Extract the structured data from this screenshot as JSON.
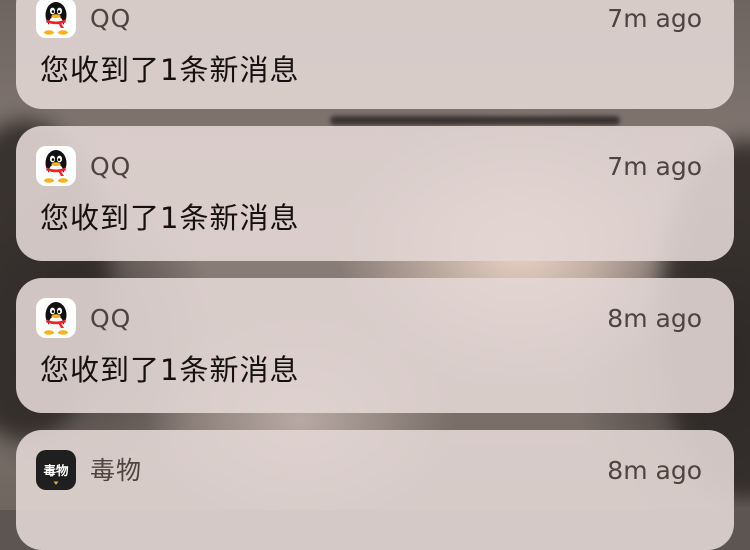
{
  "notifications": [
    {
      "app": "QQ",
      "icon": "qq-penguin-icon",
      "time": "7m ago",
      "message": "您收到了1条新消息"
    },
    {
      "app": "QQ",
      "icon": "qq-penguin-icon",
      "time": "7m ago",
      "message": "您收到了1条新消息"
    },
    {
      "app": "QQ",
      "icon": "qq-penguin-icon",
      "time": "8m ago",
      "message": "您收到了1条新消息"
    },
    {
      "app": "毒物",
      "icon": "poizon-app-icon",
      "icon_text": "毒物",
      "time": "8m ago"
    }
  ],
  "colors": {
    "card_background": "#e2d6d4",
    "secondary_text": "#4f4340",
    "primary_text": "#161110",
    "qq_scarf": "#e6262b",
    "qq_beak": "#f4b21e",
    "poizon_icon_bg": "#1f1f20"
  }
}
